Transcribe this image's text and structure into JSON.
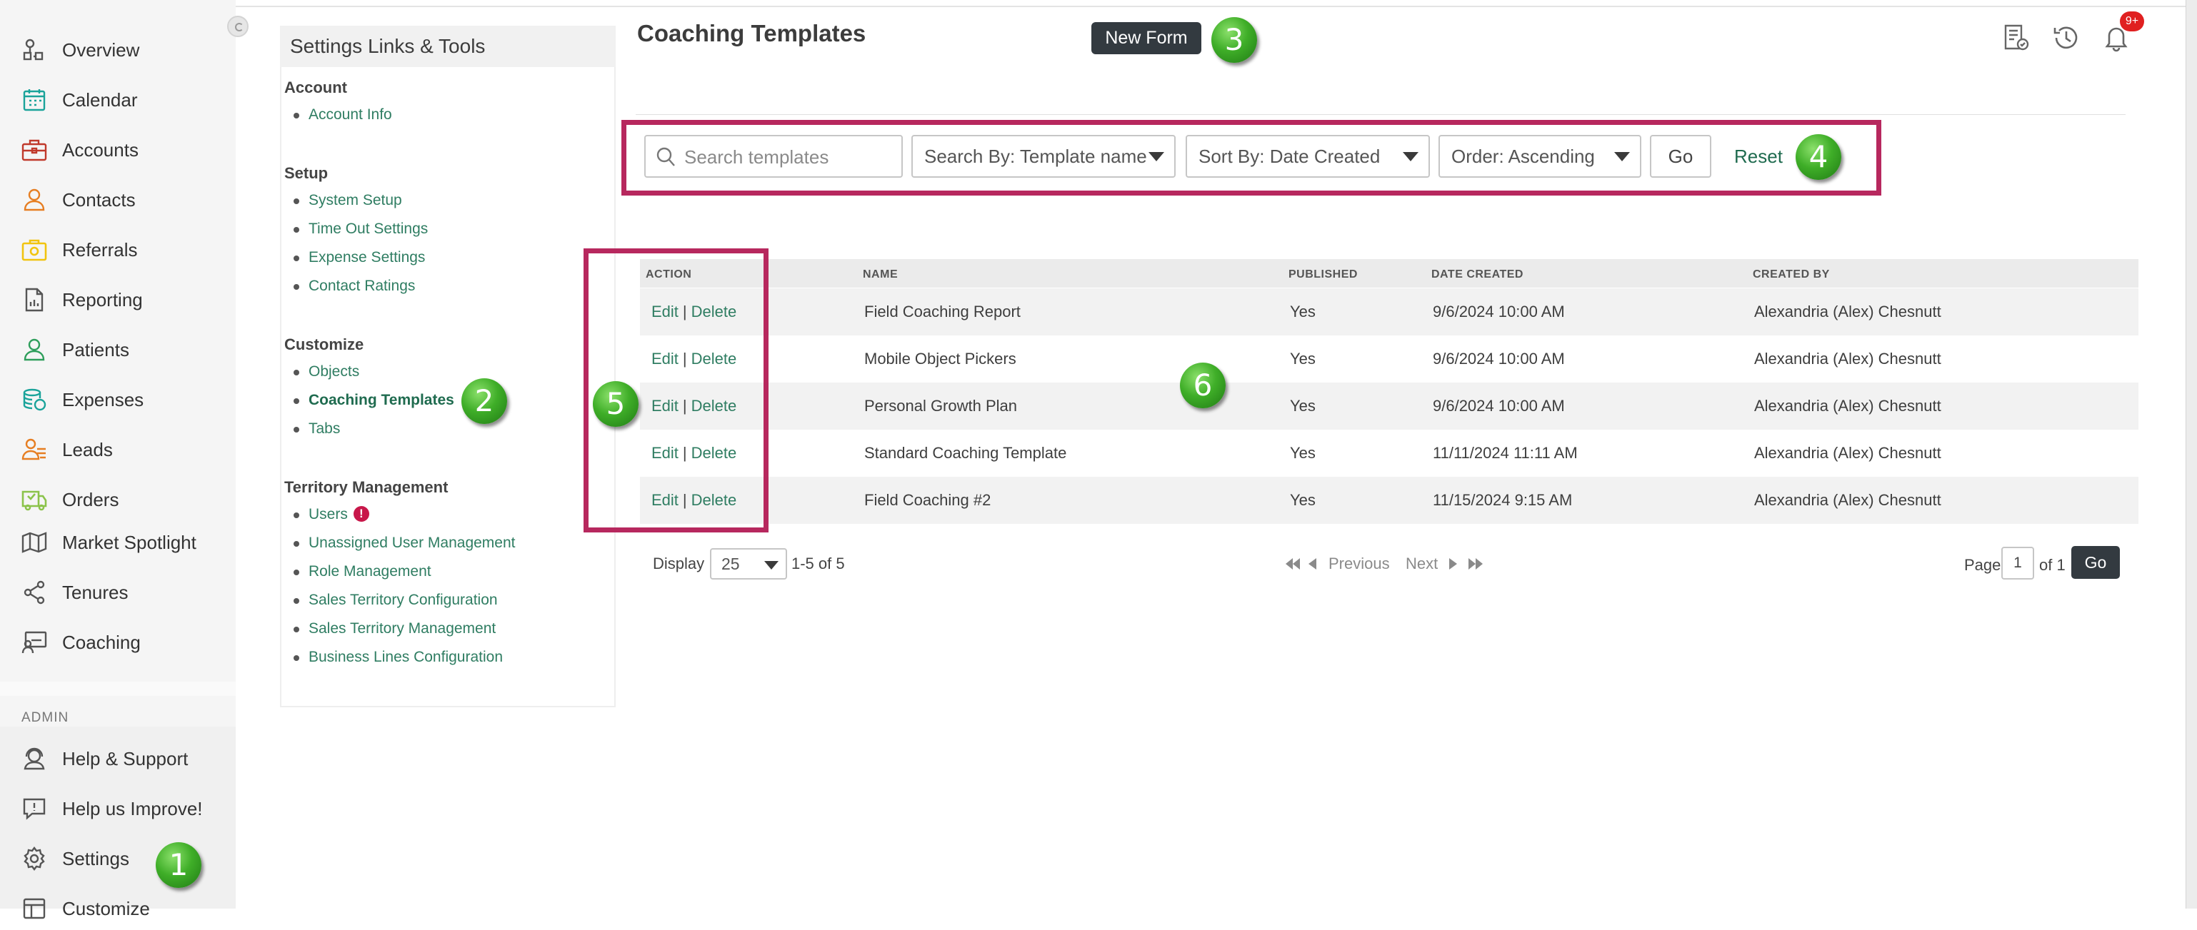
{
  "nav": {
    "items": [
      {
        "label": "Overview",
        "icon": "overview-icon",
        "color": "#555555"
      },
      {
        "label": "Calendar",
        "icon": "calendar-icon",
        "color": "#1aa39a"
      },
      {
        "label": "Accounts",
        "icon": "accounts-icon",
        "color": "#c0392b"
      },
      {
        "label": "Contacts",
        "icon": "contacts-icon",
        "color": "#e67e22"
      },
      {
        "label": "Referrals",
        "icon": "referrals-icon",
        "color": "#f1c40f"
      },
      {
        "label": "Reporting",
        "icon": "reporting-icon",
        "color": "#555555"
      },
      {
        "label": "Patients",
        "icon": "patients-icon",
        "color": "#2e9e5b"
      },
      {
        "label": "Expenses",
        "icon": "expenses-icon",
        "color": "#1aa39a"
      },
      {
        "label": "Leads",
        "icon": "leads-icon",
        "color": "#e67e22"
      },
      {
        "label": "Orders",
        "icon": "orders-icon",
        "color": "#8bc34a"
      },
      {
        "label": "Market Spotlight",
        "icon": "market-spotlight-icon",
        "color": "#555555"
      },
      {
        "label": "Tenures",
        "icon": "tenures-icon",
        "color": "#555555"
      },
      {
        "label": "Coaching",
        "icon": "coaching-icon",
        "color": "#555555"
      }
    ],
    "admin_label": "ADMIN",
    "admin_items": [
      {
        "label": "Help & Support",
        "icon": "help-support-icon"
      },
      {
        "label": "Help us Improve!",
        "icon": "feedback-icon"
      },
      {
        "label": "Settings",
        "icon": "gear-icon"
      },
      {
        "label": "Customize",
        "icon": "customize-icon"
      }
    ]
  },
  "settings": {
    "title": "Settings Links & Tools",
    "sections": [
      {
        "title": "Account",
        "links": [
          "Account Info"
        ]
      },
      {
        "title": "Setup",
        "links": [
          "System Setup",
          "Time Out Settings",
          "Expense Settings",
          "Contact Ratings"
        ]
      },
      {
        "title": "Customize",
        "links": [
          "Objects",
          "Coaching Templates",
          "Tabs"
        ]
      },
      {
        "title": "Territory Management",
        "links": [
          "Users",
          "Unassigned User Management",
          "Role Management",
          "Sales Territory Configuration",
          "Sales Territory Management",
          "Business Lines Configuration"
        ]
      }
    ],
    "active_link": "Coaching Templates",
    "users_alert": "!"
  },
  "header": {
    "title": "Coaching Templates",
    "new_form_label": "New Form",
    "notification_badge": "9+"
  },
  "filters": {
    "search_placeholder": "Search templates",
    "search_by": "Search By:  Template name",
    "sort_by": "Sort By:  Date Created",
    "order": "Order:  Ascending",
    "go_label": "Go",
    "reset_label": "Reset"
  },
  "table": {
    "columns": [
      "ACTION",
      "NAME",
      "PUBLISHED",
      "DATE CREATED",
      "CREATED BY"
    ],
    "edit_label": "Edit",
    "delete_label": "Delete",
    "separator": "|",
    "rows": [
      {
        "name": "Field Coaching Report",
        "published": "Yes",
        "date_created": "9/6/2024 10:00 AM",
        "created_by": "Alexandria (Alex) Chesnutt"
      },
      {
        "name": "Mobile Object Pickers",
        "published": "Yes",
        "date_created": "9/6/2024 10:00 AM",
        "created_by": "Alexandria (Alex) Chesnutt"
      },
      {
        "name": "Personal Growth Plan",
        "published": "Yes",
        "date_created": "9/6/2024 10:00 AM",
        "created_by": "Alexandria (Alex) Chesnutt"
      },
      {
        "name": "Standard Coaching Template",
        "published": "Yes",
        "date_created": "11/11/2024 11:11 AM",
        "created_by": "Alexandria (Alex) Chesnutt"
      },
      {
        "name": "Field Coaching #2",
        "published": "Yes",
        "date_created": "11/15/2024 9:15 AM",
        "created_by": "Alexandria (Alex) Chesnutt"
      }
    ]
  },
  "pagination": {
    "display_label": "Display",
    "page_size": "25",
    "range_text": "1-5 of 5",
    "previous_label": "Previous",
    "next_label": "Next",
    "page_label": "Page",
    "current_page": "1",
    "of_label": "of 1",
    "go_label": "Go"
  },
  "markers": [
    "1",
    "2",
    "3",
    "4",
    "5",
    "6"
  ],
  "colors": {
    "highlight_box": "#b7285e",
    "link_green": "#2f7d62",
    "dark_button": "#333a40",
    "marker_green": "#3fae28",
    "badge_red": "#e02020"
  }
}
